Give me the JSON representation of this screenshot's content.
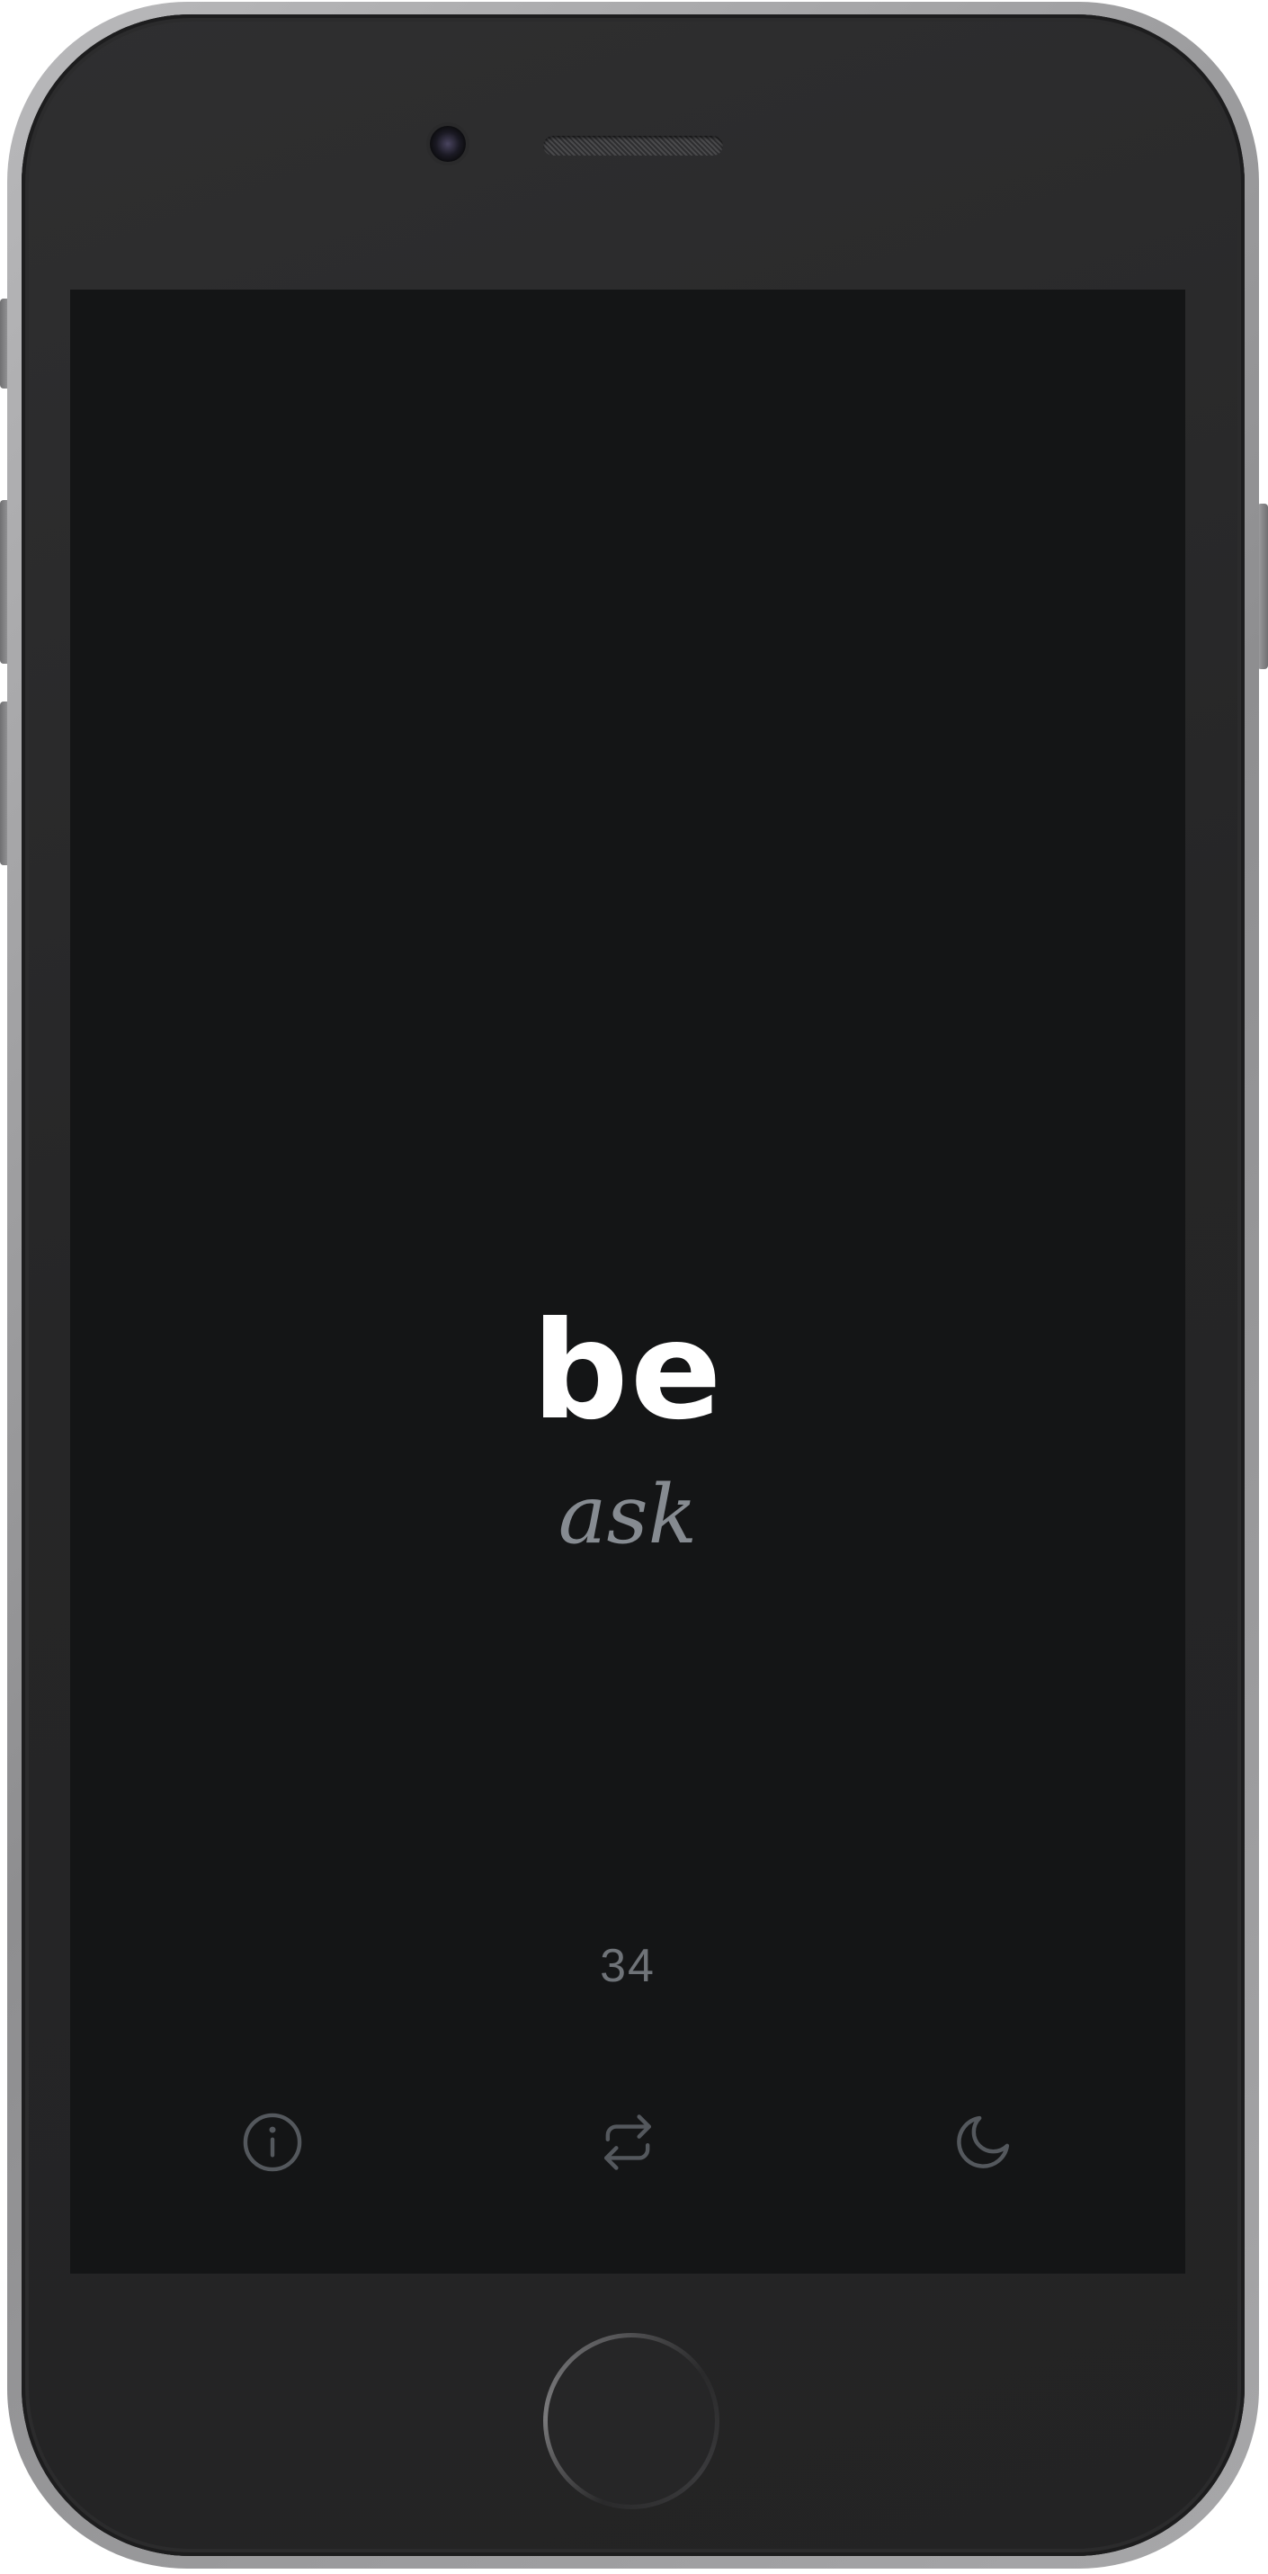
{
  "word": {
    "primary": "be",
    "secondary": "ask"
  },
  "counter": "34",
  "toolbar": {
    "info_icon": "info-circle-icon",
    "repeat_icon": "repeat-icon",
    "theme_icon": "moon-icon"
  },
  "colors": {
    "screen_background": "#141516",
    "primary_text": "#ffffff",
    "secondary_text": "#868b91",
    "icon": "#54585d",
    "counter_text": "#6f7378"
  }
}
